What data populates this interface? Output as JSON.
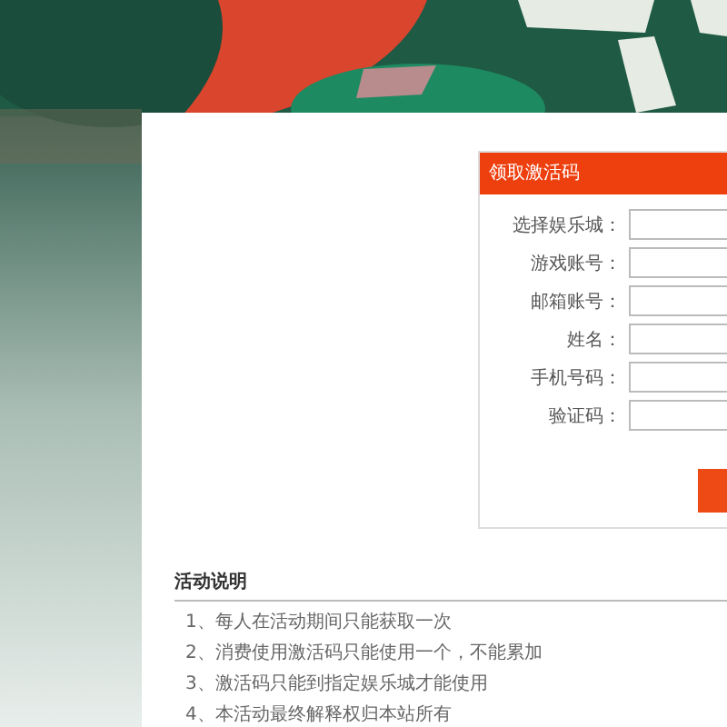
{
  "form": {
    "title": "领取激活码",
    "fields": [
      {
        "label": "选择娱乐城："
      },
      {
        "label": "游戏账号："
      },
      {
        "label": "邮箱账号："
      },
      {
        "label": "姓名："
      },
      {
        "label": "手机号码："
      },
      {
        "label": "验证码："
      }
    ]
  },
  "notes": {
    "title": "活动说明",
    "items": [
      "1、每人在活动期间只能获取一次",
      "2、消费使用激活码只能使用一个，不能累加",
      "3、激活码只能到指定娱乐城才能使用",
      "4、本活动最终解释权归本站所有"
    ]
  }
}
